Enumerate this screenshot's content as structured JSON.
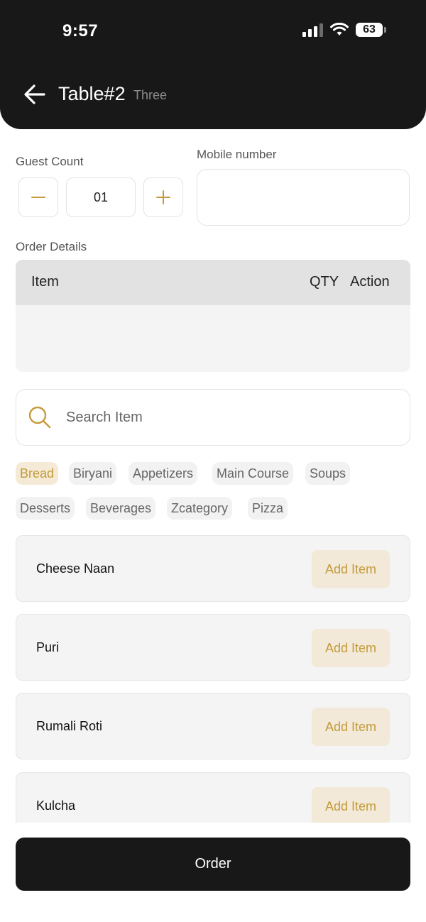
{
  "status_bar": {
    "time": "9:57",
    "battery": "63"
  },
  "header": {
    "title": "Table#2",
    "subtitle": "Three"
  },
  "guest_count": {
    "label": "Guest Count",
    "value": "01"
  },
  "mobile": {
    "label": "Mobile number",
    "value": ""
  },
  "order_details": {
    "label": "Order Details",
    "columns": {
      "item": "Item",
      "qty": "QTY",
      "action": "Action"
    }
  },
  "search": {
    "placeholder": "Search Item"
  },
  "categories": [
    {
      "label": "Bread",
      "active": true
    },
    {
      "label": "Biryani",
      "active": false
    },
    {
      "label": "Appetizers",
      "active": false
    },
    {
      "label": "Main Course",
      "active": false
    },
    {
      "label": "Soups",
      "active": false
    },
    {
      "label": "Desserts",
      "active": false
    },
    {
      "label": "Beverages",
      "active": false
    },
    {
      "label": "Zcategory",
      "active": false
    },
    {
      "label": "Pizza",
      "active": false
    }
  ],
  "menu_items": [
    {
      "name": "Cheese Naan",
      "button": "Add Item"
    },
    {
      "name": "Puri",
      "button": "Add Item"
    },
    {
      "name": "Rumali Roti",
      "button": "Add Item"
    },
    {
      "name": "Kulcha",
      "button": "Add Item"
    }
  ],
  "order_button": "Order",
  "colors": {
    "accent": "#c39b3c",
    "dark": "#181818",
    "chip_active_bg": "#f5ead6"
  }
}
